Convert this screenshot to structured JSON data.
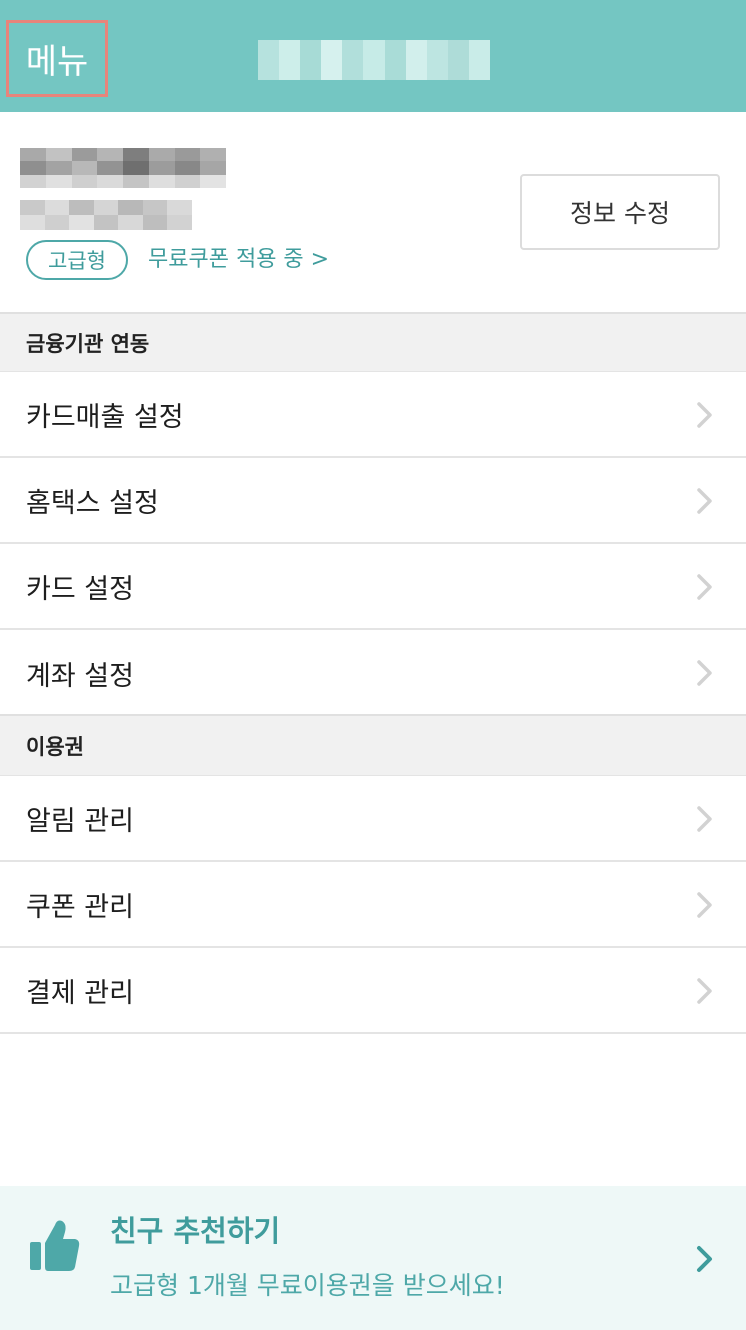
{
  "header": {
    "menu_label": "메뉴"
  },
  "profile": {
    "plan_badge": "고급형",
    "coupon_status": "무료쿠폰 적용 중 >",
    "edit_button": "정보 수정"
  },
  "sections": [
    {
      "title": "금융기관 연동",
      "items": [
        "카드매출 설정",
        "홈택스 설정",
        "카드 설정",
        "계좌 설정"
      ]
    },
    {
      "title": "이용권",
      "items": [
        "알림 관리",
        "쿠폰 관리",
        "결제 관리"
      ]
    }
  ],
  "promo": {
    "title": "친구 추천하기",
    "subtitle": "고급형 1개월 무료이용권을 받으세요!"
  },
  "colors": {
    "header_bg": "#74c6c2",
    "accent": "#3f9c9c",
    "menu_highlight": "#e8847b",
    "section_bg": "#f1f1f1",
    "promo_bg": "#eef8f7"
  }
}
